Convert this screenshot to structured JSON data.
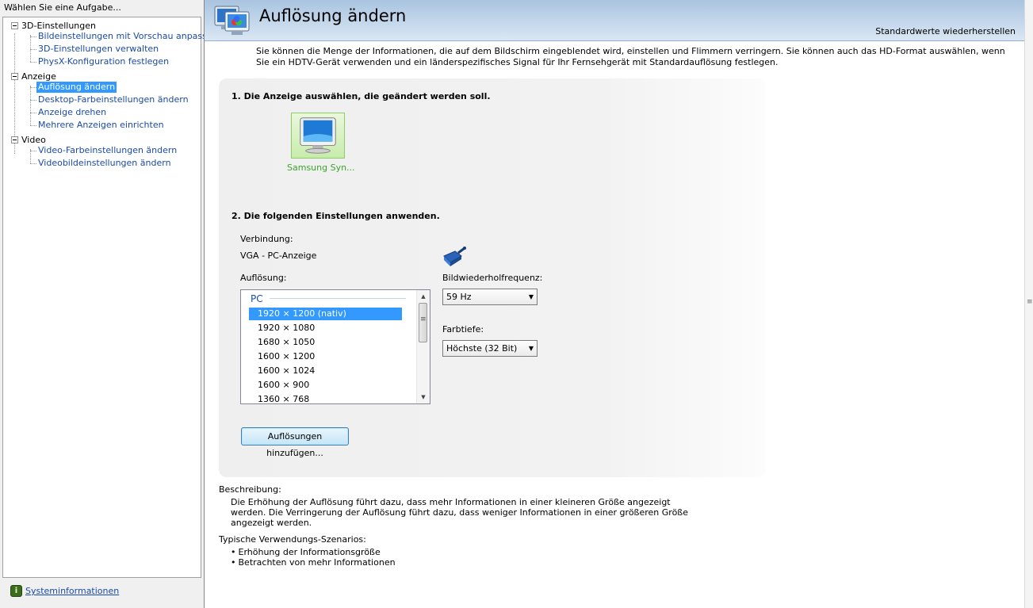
{
  "sidebar": {
    "header": "Wählen Sie eine Aufgabe...",
    "categories": [
      {
        "label": "3D-Einstellungen",
        "items": [
          "Bildeinstellungen mit Vorschau anpassen",
          "3D-Einstellungen verwalten",
          "PhysX-Konfiguration festlegen"
        ]
      },
      {
        "label": "Anzeige",
        "items": [
          "Auflösung ändern",
          "Desktop-Farbeinstellungen ändern",
          "Anzeige drehen",
          "Mehrere Anzeigen einrichten"
        ]
      },
      {
        "label": "Video",
        "items": [
          "Video-Farbeinstellungen ändern",
          "Videobildeinstellungen ändern"
        ]
      }
    ],
    "selected_item": "Auflösung ändern",
    "system_info_link": "Systeminformationen"
  },
  "page": {
    "title": "Auflösung ändern",
    "restore_defaults": "Standardwerte wiederherstellen",
    "intro": "Sie können die Menge der Informationen, die auf dem Bildschirm eingeblendet wird, einstellen und Flimmern verringern. Sie können auch das HD-Format auswählen, wenn Sie ein HDTV-Gerät verwenden und ein länderspezifisches Signal für Ihr Fernsehgerät mit Standardauflösung festlegen.",
    "step1_title": "1. Die Anzeige auswählen, die geändert werden soll.",
    "display_name": "Samsung Syn...",
    "step2_title": "2. Die folgenden Einstellungen anwenden.",
    "connection_label": "Verbindung:",
    "connection_value": "VGA - PC-Anzeige",
    "resolution_label": "Auflösung:",
    "resolution_group": "PC",
    "resolutions": [
      "1920 × 1200 (nativ)",
      "1920 × 1080",
      "1680 × 1050",
      "1600 × 1200",
      "1600 × 1024",
      "1600 × 900",
      "1360 × 768"
    ],
    "selected_resolution": "1920 × 1200 (nativ)",
    "refresh_label": "Bildwiederholfrequenz:",
    "refresh_value": "59 Hz",
    "color_depth_label": "Farbtiefe:",
    "color_depth_value": "Höchste (32 Bit)",
    "add_resolutions_button": "Auflösungen hinzufügen...",
    "description_title": "Beschreibung:",
    "description_text": "Die Erhöhung der Auflösung führt dazu, dass mehr Informationen in einer kleineren Größe angezeigt werden. Die Verringerung der Auflösung führt dazu, dass weniger Informationen in einer größeren Größe angezeigt werden.",
    "scenarios_title": "Typische Verwendungs-Szenarios:",
    "scenarios": [
      "Erhöhung der Informationsgröße",
      "Betrachten von mehr Informationen"
    ]
  },
  "icons": {
    "header": "display-settings-icon",
    "monitor": "monitor-icon",
    "connector": "vga-connector-icon",
    "system_info": "system-info-icon",
    "tree_toggle": "tree-collapse-icon"
  },
  "colors": {
    "link": "#1a4aa8",
    "selection": "#3399ff",
    "header_bg": "#c6d9ec",
    "display_label": "#3aa52a"
  }
}
